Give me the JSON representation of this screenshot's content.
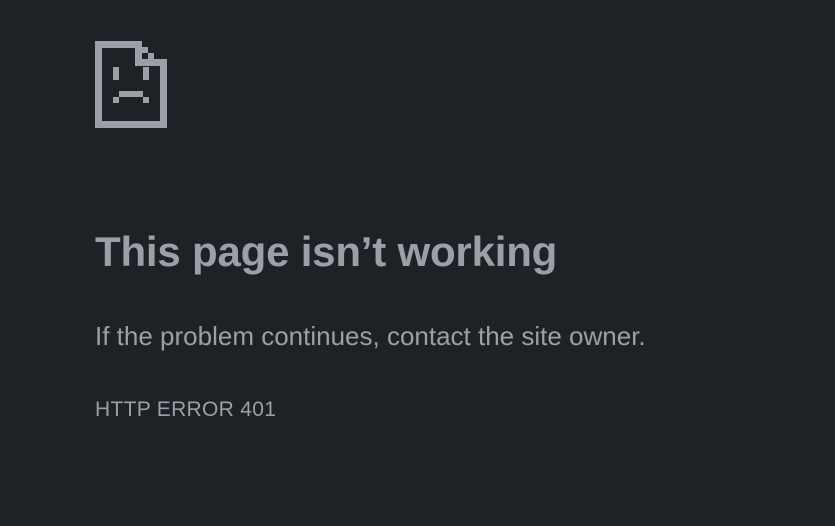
{
  "theme": {
    "background": "#202124",
    "text_color": "#9aa0a6",
    "icon_color": "#9aa0a6"
  },
  "error": {
    "icon": "sad-page-icon",
    "title": "This page isn’t working",
    "message": "If the problem continues, contact the site owner.",
    "code": "HTTP ERROR 401"
  }
}
